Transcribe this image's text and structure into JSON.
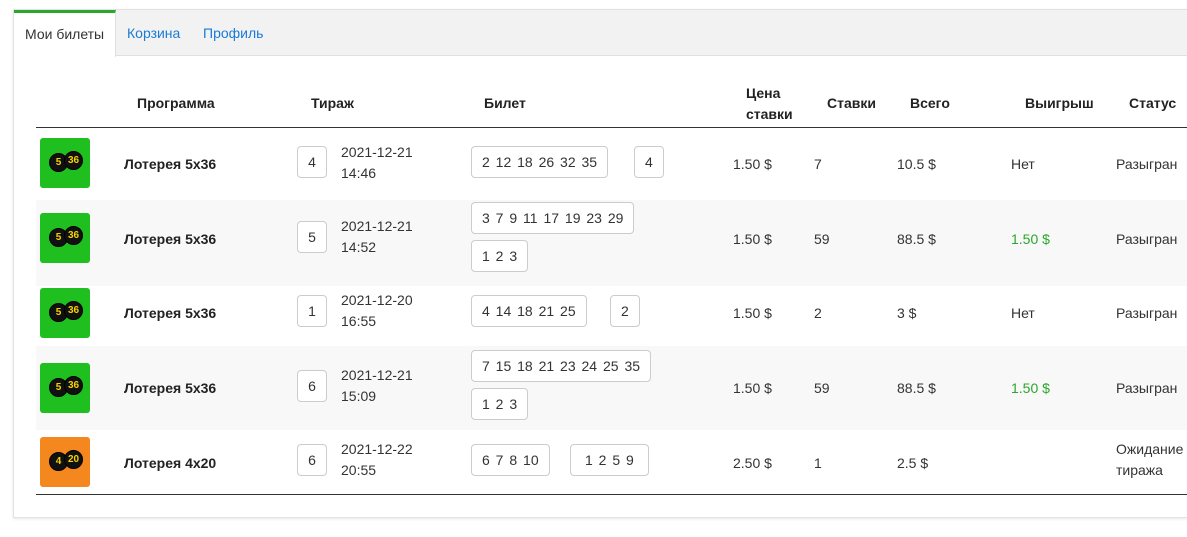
{
  "tabs": [
    {
      "label": "Мои билеты",
      "active": true
    },
    {
      "label": "Корзина",
      "active": false
    },
    {
      "label": "Профиль",
      "active": false
    }
  ],
  "columns": {
    "program": "Программа",
    "draw": "Тираж",
    "ticket": "Билет",
    "price_line1": "Цена",
    "price_line2": "ставки",
    "bets": "Ставки",
    "total": "Всего",
    "win": "Выигрыш",
    "status": "Статус"
  },
  "colors": {
    "accent": "#2aa72a",
    "link": "#1a7bd5",
    "logo_5x36": "#1fbf1f",
    "logo_4x20": "#f5871f"
  },
  "rows": [
    {
      "logo": {
        "b1": "5",
        "b2": "36"
      },
      "program": "Лотерея 5х36",
      "draw": "4",
      "date": "2021-12-21",
      "time": "14:46",
      "main_numbers": "2 12 18 26 32 35",
      "extra_numbers": "4",
      "price": "1.50 $",
      "bets": "7",
      "total": "10.5 $",
      "win": "Нет",
      "status": "Разыгран"
    },
    {
      "logo": {
        "b1": "5",
        "b2": "36"
      },
      "program": "Лотерея 5х36",
      "draw": "5",
      "date": "2021-12-21",
      "time": "14:52",
      "main_numbers": "3 7 9 11 17 19 23 29",
      "extra_numbers": "1 2 3",
      "price": "1.50 $",
      "bets": "59",
      "total": "88.5 $",
      "win": "1.50 $",
      "status": "Разыгран"
    },
    {
      "logo": {
        "b1": "5",
        "b2": "36"
      },
      "program": "Лотерея 5х36",
      "draw": "1",
      "date": "2021-12-20",
      "time": "16:55",
      "main_numbers": "4 14 18 21 25",
      "extra_numbers": "2",
      "price": "1.50 $",
      "bets": "2",
      "total": "3 $",
      "win": "Нет",
      "status": "Разыгран"
    },
    {
      "logo": {
        "b1": "5",
        "b2": "36"
      },
      "program": "Лотерея 5х36",
      "draw": "6",
      "date": "2021-12-21",
      "time": "15:09",
      "main_numbers": "7 15 18 21 23 24 25 35",
      "extra_numbers": "1 2 3",
      "price": "1.50 $",
      "bets": "59",
      "total": "88.5 $",
      "win": "1.50 $",
      "status": "Разыгран"
    },
    {
      "logo": {
        "b1": "4",
        "b2": "20"
      },
      "program": "Лотерея 4х20",
      "draw": "6",
      "date": "2021-12-22",
      "time": "20:55",
      "main_numbers": "6 7 8 10",
      "extra_numbers": "1 2 5 9",
      "price": "2.50 $",
      "bets": "1",
      "total": "2.5 $",
      "win": "",
      "status_line1": "Ожидание",
      "status_line2": "тиража"
    }
  ]
}
